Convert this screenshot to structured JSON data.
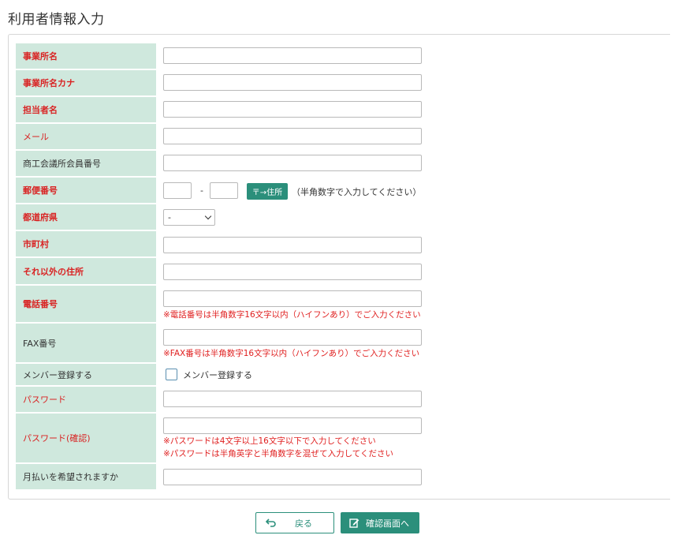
{
  "page": {
    "title": "利用者情報入力"
  },
  "fields": [
    {
      "key": "office_name",
      "label": "事業所名",
      "required": true,
      "value": ""
    },
    {
      "key": "office_kana",
      "label": "事業所名カナ",
      "required": true,
      "value": ""
    },
    {
      "key": "contact_name",
      "label": "担当者名",
      "required": true,
      "value": ""
    },
    {
      "key": "email",
      "label": "メール",
      "required": true,
      "value": ""
    },
    {
      "key": "chamber_member_no",
      "label": "商工会議所会員番号",
      "required": false,
      "value": ""
    },
    {
      "key": "postal_code",
      "label": "郵便番号",
      "required": true,
      "value_1": "",
      "value_2": "",
      "separator": "-",
      "button_label": "〒→住所",
      "note": "（半角数字で入力してください）"
    },
    {
      "key": "prefecture",
      "label": "都道府県",
      "required": true,
      "selected": "-"
    },
    {
      "key": "city",
      "label": "市町村",
      "required": true,
      "value": ""
    },
    {
      "key": "address_other",
      "label": "それ以外の住所",
      "required": true,
      "value": ""
    },
    {
      "key": "phone",
      "label": "電話番号",
      "required": true,
      "value": "",
      "note": "※電話番号は半角数字16文字以内（ハイフンあり）でご入力ください"
    },
    {
      "key": "fax",
      "label": "FAX番号",
      "required": false,
      "value": "",
      "note": "※FAX番号は半角数字16文字以内（ハイフンあり）でご入力ください"
    },
    {
      "key": "member_register",
      "label": "メンバー登録する",
      "required": false,
      "checkbox_label": "メンバー登録する",
      "checked": false
    },
    {
      "key": "password",
      "label": "パスワード",
      "required": true,
      "value": ""
    },
    {
      "key": "password_confirm",
      "label": "パスワード(確認)",
      "required": true,
      "value": "",
      "notes": [
        "※パスワードは4文字以上16文字以下で入力してください",
        "※パスワードは半角英字と半角数字を混ぜて入力してください"
      ]
    },
    {
      "key": "monthly_payment",
      "label": "月払いを希望されますか",
      "required": false,
      "value": ""
    }
  ],
  "actions": {
    "back_label": "戻る",
    "next_label": "確認画面へ"
  },
  "colors": {
    "label_bg": "#cfe8dd",
    "required_text": "#d92323",
    "accent": "#2b8f7b",
    "error_note": "#e02020"
  },
  "icons": {
    "back": "return-arrow-icon",
    "next": "edit-icon",
    "select": "chevron-down-icon"
  }
}
